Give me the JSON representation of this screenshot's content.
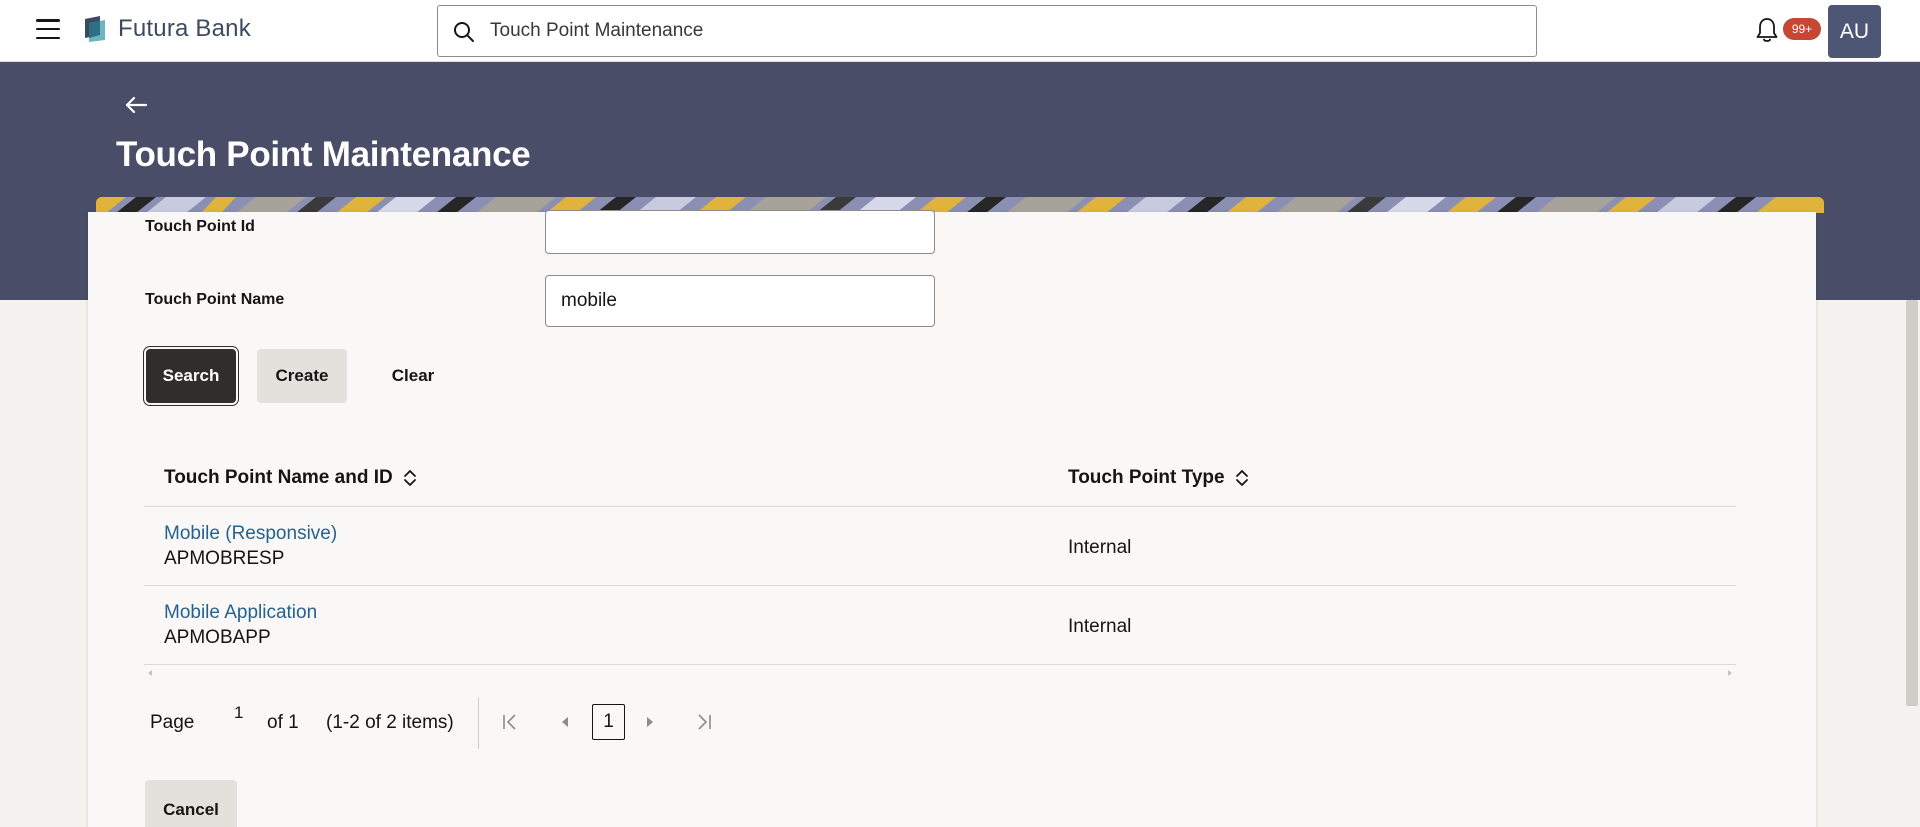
{
  "header": {
    "brand": "Futura Bank",
    "search_value": "Touch Point Maintenance",
    "notification_count": "99+",
    "avatar_initials": "AU"
  },
  "page": {
    "title": "Touch Point Maintenance"
  },
  "form": {
    "id_label": "Touch Point Id",
    "id_value": "",
    "name_label": "Touch Point Name",
    "name_value": "mobile",
    "search_label": "Search",
    "create_label": "Create",
    "clear_label": "Clear"
  },
  "table": {
    "columns": [
      "Touch Point Name and ID",
      "Touch Point Type"
    ],
    "rows": [
      {
        "name": "Mobile (Responsive)",
        "id": "APMOBRESP",
        "type": "Internal"
      },
      {
        "name": "Mobile Application",
        "id": "APMOBAPP",
        "type": "Internal"
      }
    ]
  },
  "pagination": {
    "page_label": "Page",
    "current_page": "1",
    "of_label": "of 1",
    "items_label": "(1-2 of 2 items)",
    "page_button": "1"
  },
  "footer": {
    "cancel_label": "Cancel"
  },
  "colors": {
    "banner": "#4a4d68",
    "primary_button": "#312d2a",
    "link": "#25628f",
    "badge": "#c74634",
    "avatar": "#4e5675"
  },
  "icons": [
    "hamburger-icon",
    "logo-icon",
    "search-icon",
    "bell-icon",
    "back-arrow-icon",
    "sort-icon",
    "first-page-icon",
    "prev-page-icon",
    "next-page-icon",
    "last-page-icon"
  ]
}
